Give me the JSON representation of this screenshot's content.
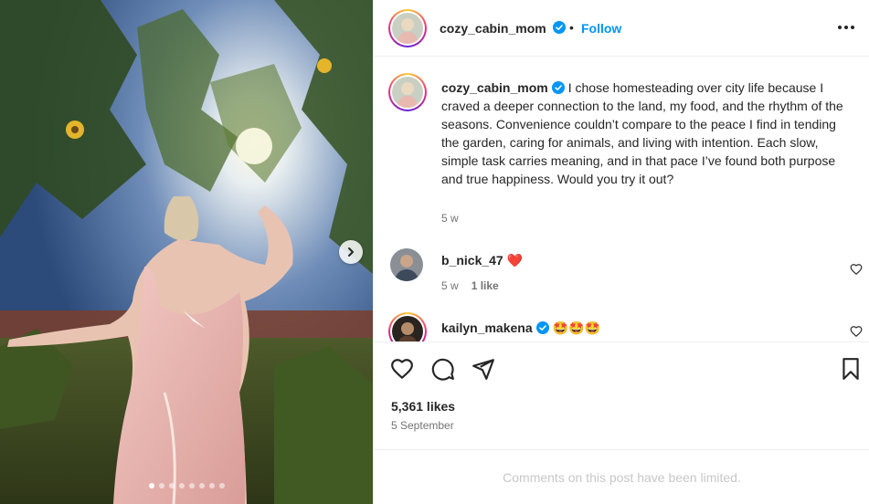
{
  "post": {
    "author": "cozy_cabin_mom",
    "follow_label": "Follow",
    "bullet": "•",
    "caption": "I chose homesteading over city life because I craved a deeper connection to the land, my food, and the rhythm of the seasons. Convenience couldn’t compare to the peace I find in tending the garden, caring for animals, and living with intention. Each slow, simple task carries meaning, and in that pace I’ve found both purpose and true happiness. Would you try it out?",
    "caption_time": "5 w",
    "likes": "5,361 likes",
    "date": "5 September",
    "comments_limited": "Comments on this post have been limited."
  },
  "carousel": {
    "slide_count": 8,
    "active_index": 0
  },
  "comments": [
    {
      "username": "b_nick_47",
      "text": "❤️",
      "time": "5 w",
      "likes": "1 like"
    },
    {
      "username": "kailyn_makena",
      "text": "🤩🤩🤩"
    }
  ],
  "icons": {
    "verified": "verified-badge-icon",
    "more": "more-options-icon",
    "like": "heart-icon",
    "comment": "comment-icon",
    "share": "share-icon",
    "save": "bookmark-icon",
    "next": "chevron-right-icon"
  },
  "colors": {
    "accent": "#0095f6",
    "text": "#262626",
    "muted": "#737373",
    "limited": "#c7c7c7"
  }
}
